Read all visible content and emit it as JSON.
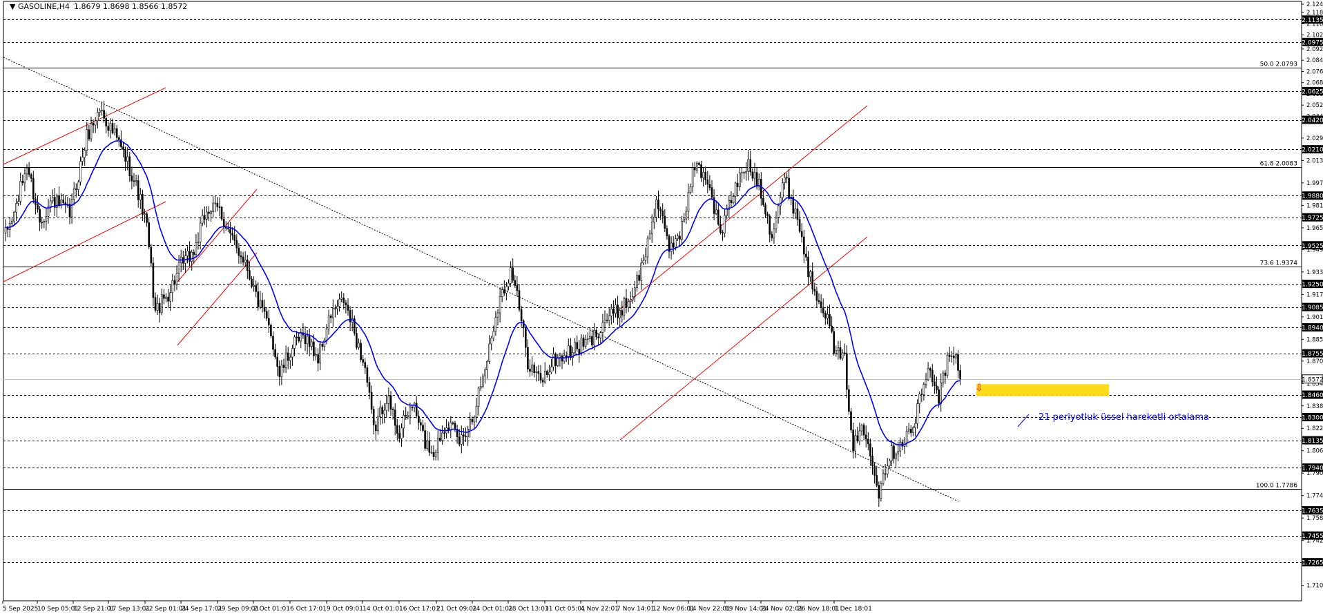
{
  "header": {
    "symbol": "GASOLINE,H4",
    "ohlc": "1.8679 1.8698 1.8566 1.8572"
  },
  "colors": {
    "background": "#ffffff",
    "grid": "#000000",
    "candle": "#000000",
    "ema": "#0000ff",
    "channel": "#ff0000",
    "trendline": "#000000",
    "zone": "#ffd700",
    "label_bg": "#000000",
    "label_text": "#ffffff",
    "annotation": "#0000ff",
    "arrow": "#ff0000"
  },
  "annotation": {
    "text": "21 periyotluk üssel hareketli ortalama"
  },
  "chart_data": {
    "type": "candlestick",
    "ylim": [
      1.699,
      2.1245
    ],
    "y_ticks": [
      "2.1245",
      "2.1185",
      "2.1105",
      "2.1025",
      "2.0925",
      "2.0845",
      "2.0765",
      "2.0685",
      "2.0605",
      "2.0525",
      "2.0445",
      "2.0290",
      "2.0130",
      "1.9970",
      "1.9810",
      "1.9650",
      "1.9495",
      "1.9335",
      "1.9175",
      "1.9015",
      "1.8855",
      "1.8700",
      "1.8540",
      "1.8380",
      "1.8220",
      "1.8060",
      "1.7900",
      "1.7740",
      "1.7580",
      "1.7420",
      "1.7100"
    ],
    "x_ticks": [
      "5 Sep 2025",
      "10 Sep 05:01",
      "12 Sep 21:01",
      "17 Sep 13:01",
      "22 Sep 01:01",
      "24 Sep 17:01",
      "29 Sep 09:01",
      "2 Oct 01:01",
      "6 Oct 17:01",
      "9 Oct 09:01",
      "14 Oct 01:01",
      "16 Oct 17:01",
      "21 Oct 09:01",
      "24 Oct 01:01",
      "28 Oct 13:01",
      "31 Oct 05:01",
      "4 Nov 22:01",
      "7 Nov 14:01",
      "12 Nov 06:01",
      "14 Nov 22:01",
      "19 Nov 14:01",
      "24 Nov 02:01",
      "26 Nov 18:01",
      "1 Dec 18:01"
    ],
    "horizontal_levels": [
      {
        "value": 2.1135,
        "label": "2.1135"
      },
      {
        "value": 2.0975,
        "label": "2.0975"
      },
      {
        "value": 2.0625,
        "label": "2.0625"
      },
      {
        "value": 2.042,
        "label": "2.0420"
      },
      {
        "value": 2.021,
        "label": "2.0210"
      },
      {
        "value": 1.988,
        "label": "1.9880"
      },
      {
        "value": 1.9725,
        "label": "1.9725"
      },
      {
        "value": 1.9525,
        "label": "1.9525"
      },
      {
        "value": 1.925,
        "label": "1.9250"
      },
      {
        "value": 1.9085,
        "label": "1.9085"
      },
      {
        "value": 1.894,
        "label": "1.8940"
      },
      {
        "value": 1.8755,
        "label": "1.8755"
      },
      {
        "value": 1.846,
        "label": "1.8460"
      },
      {
        "value": 1.83,
        "label": "1.8300"
      },
      {
        "value": 1.8135,
        "label": "1.8135"
      },
      {
        "value": 1.794,
        "label": "1.7940"
      },
      {
        "value": 1.7635,
        "label": "1.7635"
      },
      {
        "value": 1.7455,
        "label": "1.7455"
      },
      {
        "value": 1.7265,
        "label": "1.7265"
      }
    ],
    "fibonacci": [
      {
        "value": 2.0793,
        "label": "50.0 2.0793"
      },
      {
        "value": 2.0083,
        "label": "61.8 2.0083"
      },
      {
        "value": 1.9374,
        "label": "73.6 1.9374"
      },
      {
        "value": 1.7786,
        "label": "100.0 1.7786"
      }
    ],
    "current_price": {
      "value": 1.8572,
      "label": "1.8572"
    },
    "anchors": [
      [
        0,
        1.96
      ],
      [
        4,
        1.975
      ],
      [
        10,
        2.01
      ],
      [
        16,
        1.97
      ],
      [
        22,
        1.985
      ],
      [
        30,
        1.975
      ],
      [
        38,
        2.03
      ],
      [
        44,
        2.05
      ],
      [
        52,
        2.028
      ],
      [
        58,
        2.008
      ],
      [
        62,
        1.99
      ],
      [
        66,
        1.965
      ],
      [
        70,
        1.905
      ],
      [
        76,
        1.918
      ],
      [
        82,
        1.938
      ],
      [
        88,
        1.948
      ],
      [
        94,
        1.978
      ],
      [
        100,
        1.978
      ],
      [
        106,
        1.955
      ],
      [
        112,
        1.942
      ],
      [
        118,
        1.912
      ],
      [
        124,
        1.89
      ],
      [
        128,
        1.86
      ],
      [
        134,
        1.88
      ],
      [
        140,
        1.888
      ],
      [
        146,
        1.872
      ],
      [
        152,
        1.903
      ],
      [
        158,
        1.913
      ],
      [
        162,
        1.895
      ],
      [
        168,
        1.865
      ],
      [
        172,
        1.82
      ],
      [
        178,
        1.845
      ],
      [
        184,
        1.818
      ],
      [
        190,
        1.84
      ],
      [
        196,
        1.812
      ],
      [
        200,
        1.805
      ],
      [
        206,
        1.828
      ],
      [
        212,
        1.812
      ],
      [
        218,
        1.83
      ],
      [
        224,
        1.865
      ],
      [
        230,
        1.91
      ],
      [
        236,
        1.935
      ],
      [
        238,
        1.925
      ],
      [
        244,
        1.87
      ],
      [
        250,
        1.855
      ],
      [
        256,
        1.87
      ],
      [
        262,
        1.875
      ],
      [
        268,
        1.88
      ],
      [
        274,
        1.885
      ],
      [
        280,
        1.9
      ],
      [
        286,
        1.905
      ],
      [
        292,
        1.915
      ],
      [
        298,
        1.94
      ],
      [
        304,
        1.985
      ],
      [
        310,
        1.95
      ],
      [
        316,
        1.965
      ],
      [
        322,
        2.01
      ],
      [
        328,
        2.0
      ],
      [
        334,
        1.96
      ],
      [
        340,
        1.99
      ],
      [
        346,
        2.01
      ],
      [
        352,
        1.998
      ],
      [
        358,
        1.96
      ],
      [
        364,
        2.0
      ],
      [
        370,
        1.972
      ],
      [
        376,
        1.928
      ],
      [
        382,
        1.91
      ],
      [
        388,
        1.875
      ],
      [
        392,
        1.87
      ],
      [
        396,
        1.808
      ],
      [
        400,
        1.822
      ],
      [
        404,
        1.808
      ],
      [
        408,
        1.778
      ],
      [
        412,
        1.8
      ],
      [
        418,
        1.812
      ],
      [
        424,
        1.822
      ],
      [
        428,
        1.848
      ],
      [
        432,
        1.865
      ],
      [
        436,
        1.845
      ],
      [
        440,
        1.87
      ],
      [
        444,
        1.872
      ],
      [
        446,
        1.857
      ]
    ],
    "bar_count": 447,
    "ema_period": 21,
    "zone": {
      "from": 1.845,
      "to": 1.8535
    }
  }
}
